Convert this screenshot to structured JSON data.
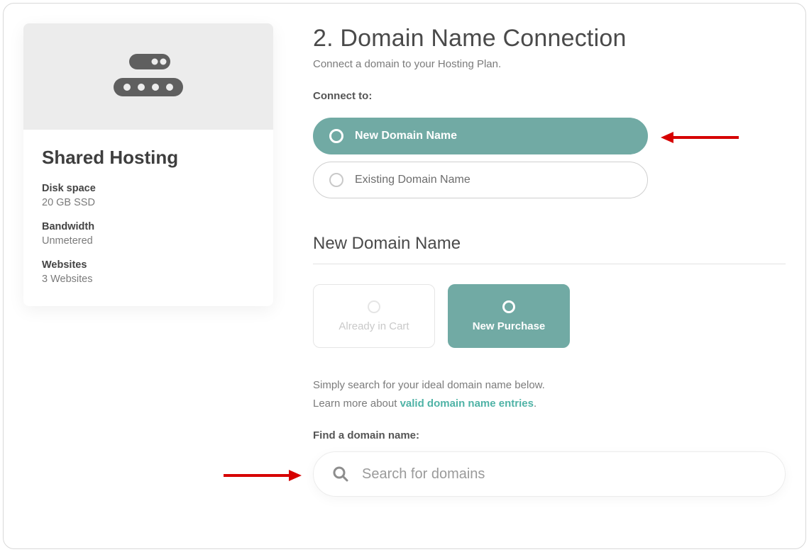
{
  "plan": {
    "title": "Shared Hosting",
    "disk_label": "Disk space",
    "disk_value": "20 GB SSD",
    "bw_label": "Bandwidth",
    "bw_value": "Unmetered",
    "sites_label": "Websites",
    "sites_value": "3 Websites"
  },
  "page": {
    "title": "2. Domain Name Connection",
    "subtitle": "Connect a domain to your Hosting Plan.",
    "connect_label": "Connect to:"
  },
  "options": {
    "new": "New Domain Name",
    "existing": "Existing Domain Name"
  },
  "section": {
    "title": "New Domain Name"
  },
  "tabs": {
    "cart": "Already in Cart",
    "purchase": "New Purchase"
  },
  "helper": {
    "line1": "Simply search for your ideal domain name below.",
    "line2_prefix": "Learn more about ",
    "link": "valid domain name entries",
    "period": "."
  },
  "search": {
    "label": "Find a domain name:",
    "placeholder": "Search for domains"
  }
}
